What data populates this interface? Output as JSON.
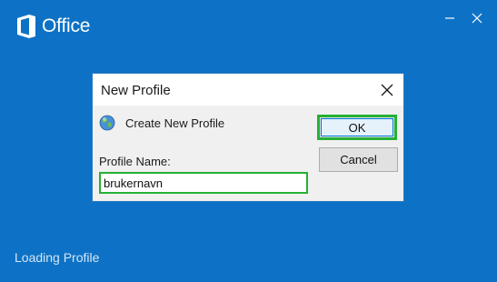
{
  "splash": {
    "app_name": "Office",
    "status": "Loading Profile"
  },
  "window_controls": {
    "minimize_icon": "minimize-icon",
    "close_icon": "close-icon"
  },
  "dialog": {
    "title": "New Profile",
    "create_label": "Create New Profile",
    "profile_name_label": "Profile Name:",
    "profile_name_value": "brukernavn",
    "ok_label": "OK",
    "cancel_label": "Cancel"
  },
  "colors": {
    "background": "#0d72c5",
    "highlight": "#25b035"
  }
}
